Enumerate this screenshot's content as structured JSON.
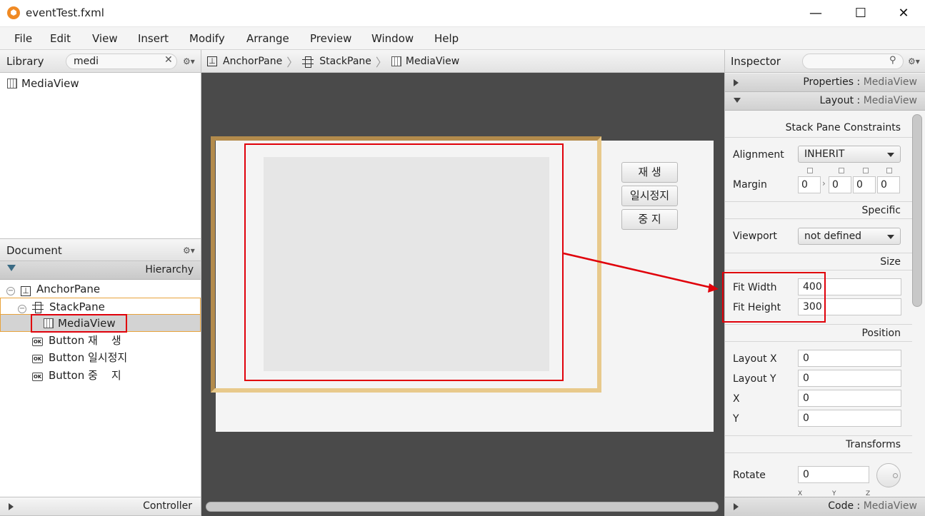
{
  "window": {
    "title": "eventTest.fxml",
    "minimize": "—",
    "maximize": "☐",
    "close": "✕"
  },
  "menu": [
    "File",
    "Edit",
    "View",
    "Insert",
    "Modify",
    "Arrange",
    "Preview",
    "Window",
    "Help"
  ],
  "library": {
    "label": "Library",
    "search_value": "medi",
    "clear": "✕",
    "gear": "⚙▾",
    "items": [
      "MediaView"
    ]
  },
  "document": {
    "label": "Document",
    "gear": "⚙▾",
    "hierarchy_label": "Hierarchy",
    "tree": [
      {
        "icon": "anchor",
        "label": "AnchorPane"
      },
      {
        "icon": "stack",
        "label": "StackPane"
      },
      {
        "icon": "media",
        "label": "MediaView"
      },
      {
        "icon": "button",
        "label": "Button 재    생"
      },
      {
        "icon": "button",
        "label": "Button 일시정지"
      },
      {
        "icon": "button",
        "label": "Button 중    지"
      }
    ],
    "controller_label": "Controller"
  },
  "breadcrumb": [
    "AnchorPane",
    "StackPane",
    "MediaView"
  ],
  "canvas": {
    "buttons": [
      "재    생",
      "일시정지",
      "중    지"
    ]
  },
  "inspector": {
    "label": "Inspector",
    "gear": "⚙▾",
    "properties_section": "Properties",
    "layout_section": "Layout",
    "code_section": "Code",
    "target": "MediaView",
    "stack_constraints": "Stack Pane Constraints",
    "alignment_label": "Alignment",
    "alignment_value": "INHERIT",
    "margin_label": "Margin",
    "margin_values": [
      "0",
      "0",
      "0",
      "0"
    ],
    "specific_label": "Specific",
    "viewport_label": "Viewport",
    "viewport_value": "not defined",
    "size_label": "Size",
    "fit_width_label": "Fit Width",
    "fit_width_value": "400",
    "fit_height_label": "Fit Height",
    "fit_height_value": "300",
    "position_label": "Position",
    "layout_x_label": "Layout X",
    "layout_x_value": "0",
    "layout_y_label": "Layout Y",
    "layout_y_value": "0",
    "x_label": "X",
    "x_value": "0",
    "y_label": "Y",
    "y_value": "0",
    "transforms_label": "Transforms",
    "rotate_label": "Rotate",
    "rotate_value": "0",
    "axis_labels": [
      "X",
      "Y",
      "Z"
    ]
  },
  "colors": {
    "highlight": "#e0000a",
    "selection_outline": "#e8c98b",
    "canvas_bg": "#4a4a4a"
  }
}
